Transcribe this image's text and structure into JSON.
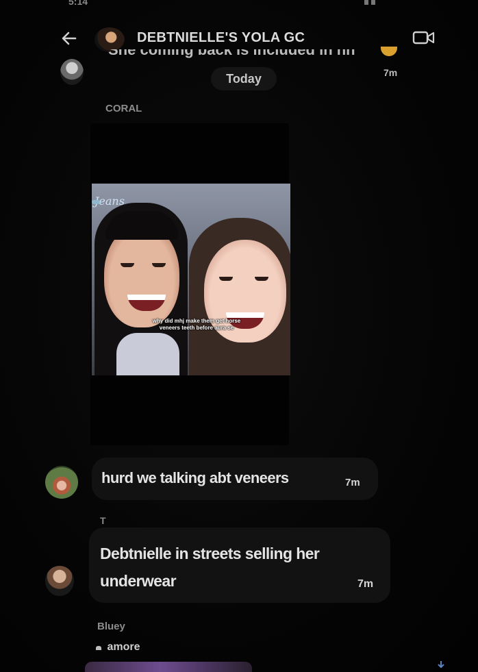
{
  "status_bar": {
    "time": "5:14"
  },
  "header": {
    "title": "DEBTNIELLE'S YOLA GC",
    "back_icon": "arrow-left-icon",
    "video_icon": "video-camera-icon"
  },
  "previous_message": {
    "text": "She coming back is included in hh",
    "time": "7m"
  },
  "date_separator": "Today",
  "messages": [
    {
      "sender": "CORAL",
      "type": "video",
      "overlay_label": "Jeans",
      "caption": "why did mhj make them get horse veneers teeth before aura se"
    },
    {
      "type": "text",
      "text": "hurd we talking abt veneers",
      "time": "7m"
    },
    {
      "sender": "T",
      "type": "text",
      "text": "Debtnielle in streets selling her underwear",
      "time": "7m"
    },
    {
      "sender": "Bluey",
      "type": "reply",
      "text": "amore"
    }
  ],
  "colors": {
    "background": "#050505",
    "bubble": "#121212",
    "text": "#e4e4e4",
    "muted": "#8c8c8c"
  }
}
